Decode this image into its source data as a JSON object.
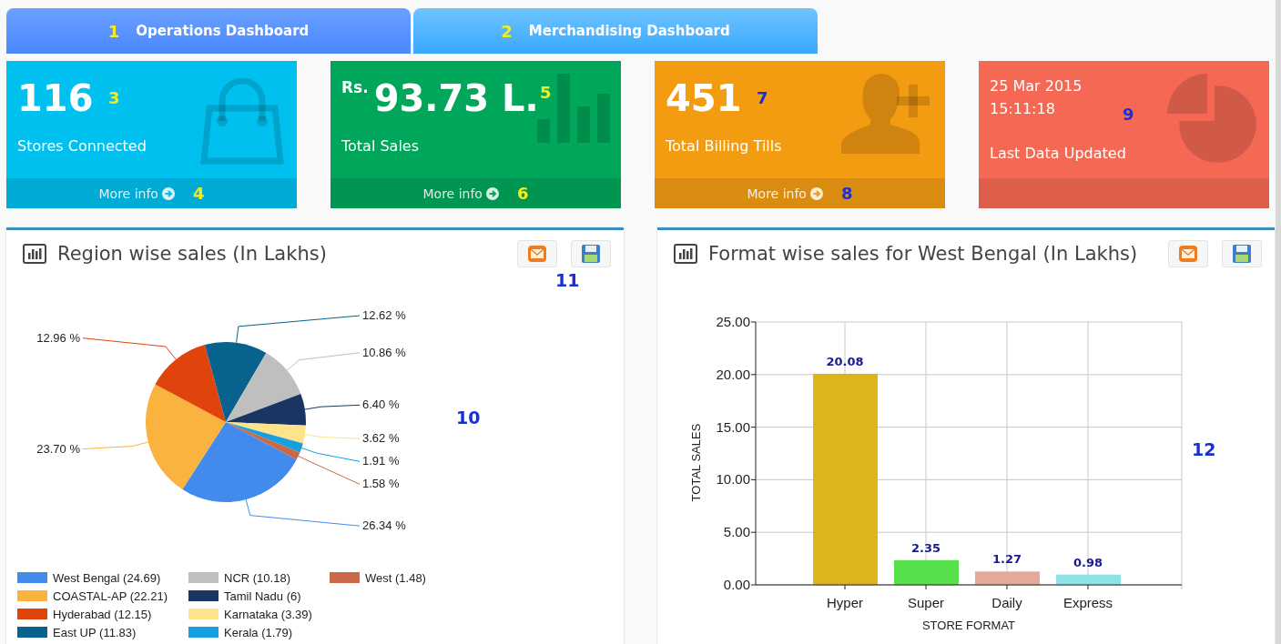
{
  "tabs": [
    {
      "label": "Operations Dashboard",
      "selected": true,
      "marker": {
        "text": "1",
        "color": "#f2ee1f"
      }
    },
    {
      "label": "Merchandising Dashboard",
      "selected": false,
      "marker": {
        "text": "2",
        "color": "#f2ee1f"
      }
    }
  ],
  "cards": [
    {
      "kind": "bag",
      "color": "#00c0ef",
      "value": "116",
      "label": "Stores Connected",
      "more": "More info",
      "marker": {
        "text": "3",
        "color": "#f2ee1f"
      },
      "footer_marker": {
        "text": "4",
        "color": "#f2ee1f"
      }
    },
    {
      "kind": "bars",
      "color": "#00a65a",
      "value_prefix": "Rs.",
      "value": "93.73 L.",
      "label": "Total Sales",
      "more": "More info",
      "marker": {
        "text": "5",
        "color": "#f2ee1f"
      },
      "footer_marker": {
        "text": "6",
        "color": "#f2ee1f"
      }
    },
    {
      "kind": "user-plus",
      "color": "#f39c12",
      "value": "451",
      "label": "Total Billing Tills",
      "more": "More info",
      "marker": {
        "text": "7",
        "color": "#1b2fd6"
      },
      "footer_marker": {
        "text": "8",
        "color": "#1b2fd6"
      }
    },
    {
      "kind": "pie",
      "color": "#f56954",
      "lines": [
        "25 Mar 2015",
        "15:11:18"
      ],
      "label": "Last Data Updated",
      "marker": {
        "text": "9",
        "color": "#1b2fd6"
      }
    }
  ],
  "panels": [
    {
      "title": "Region wise sales (In Lakhs)",
      "button_marker": {
        "text": "11",
        "color": "#1b2fd6"
      },
      "chart_marker": {
        "text": "10",
        "color": "#1b2fd6"
      },
      "chart_data": {
        "type": "pie",
        "categories": [
          "West Bengal (24.69)",
          "COASTAL-AP (22.21)",
          "Hyderabad (12.15)",
          "East UP (11.83)",
          "NCR (10.18)",
          "Tamil Nadu (6)",
          "Karnataka (3.39)",
          "Kerala (1.79)",
          "West (1.48)"
        ],
        "values": [
          26.34,
          23.7,
          12.96,
          12.62,
          10.86,
          6.4,
          3.62,
          1.91,
          1.58
        ],
        "colors": [
          "#428bed",
          "#fab33f",
          "#e0430c",
          "#07628e",
          "#bfbfbf",
          "#1a3562",
          "#fde38a",
          "#179ee0",
          "#c9694a"
        ],
        "value_labels": [
          "26.34 %",
          "23.70 %",
          "12.96 %",
          "12.62 %",
          "10.86 %",
          "6.40 %",
          "3.62 %",
          "1.91 %",
          "1.58 %"
        ],
        "legend": true
      }
    },
    {
      "title": "Format wise sales for West Bengal (In Lakhs)",
      "chart_marker": {
        "text": "12",
        "color": "#1b2fd6"
      },
      "chart_data": {
        "type": "bar",
        "xlabel": "STORE FORMAT",
        "ylabel": "TOTAL SALES",
        "categories": [
          "Hyper",
          "Super",
          "Daily",
          "Express"
        ],
        "series": [
          {
            "colors": [
              "#dbb51b",
              "#56e04b",
              "#e2ab99",
              "#8de3e8"
            ],
            "values": [
              20.08,
              2.35,
              1.27,
              0.98
            ]
          }
        ],
        "value_labels": [
          "20.08",
          "2.35",
          "1.27",
          "0.98"
        ],
        "ylim": [
          0,
          25
        ],
        "grid": true,
        "yticks": [
          {
            "value": 0,
            "label": "0.00"
          },
          {
            "value": 5,
            "label": "5.00"
          },
          {
            "value": 10,
            "label": "10.00"
          },
          {
            "value": 15,
            "label": "15.00"
          },
          {
            "value": 20,
            "label": "20.00"
          },
          {
            "value": 25,
            "label": "25.00"
          }
        ]
      }
    }
  ]
}
